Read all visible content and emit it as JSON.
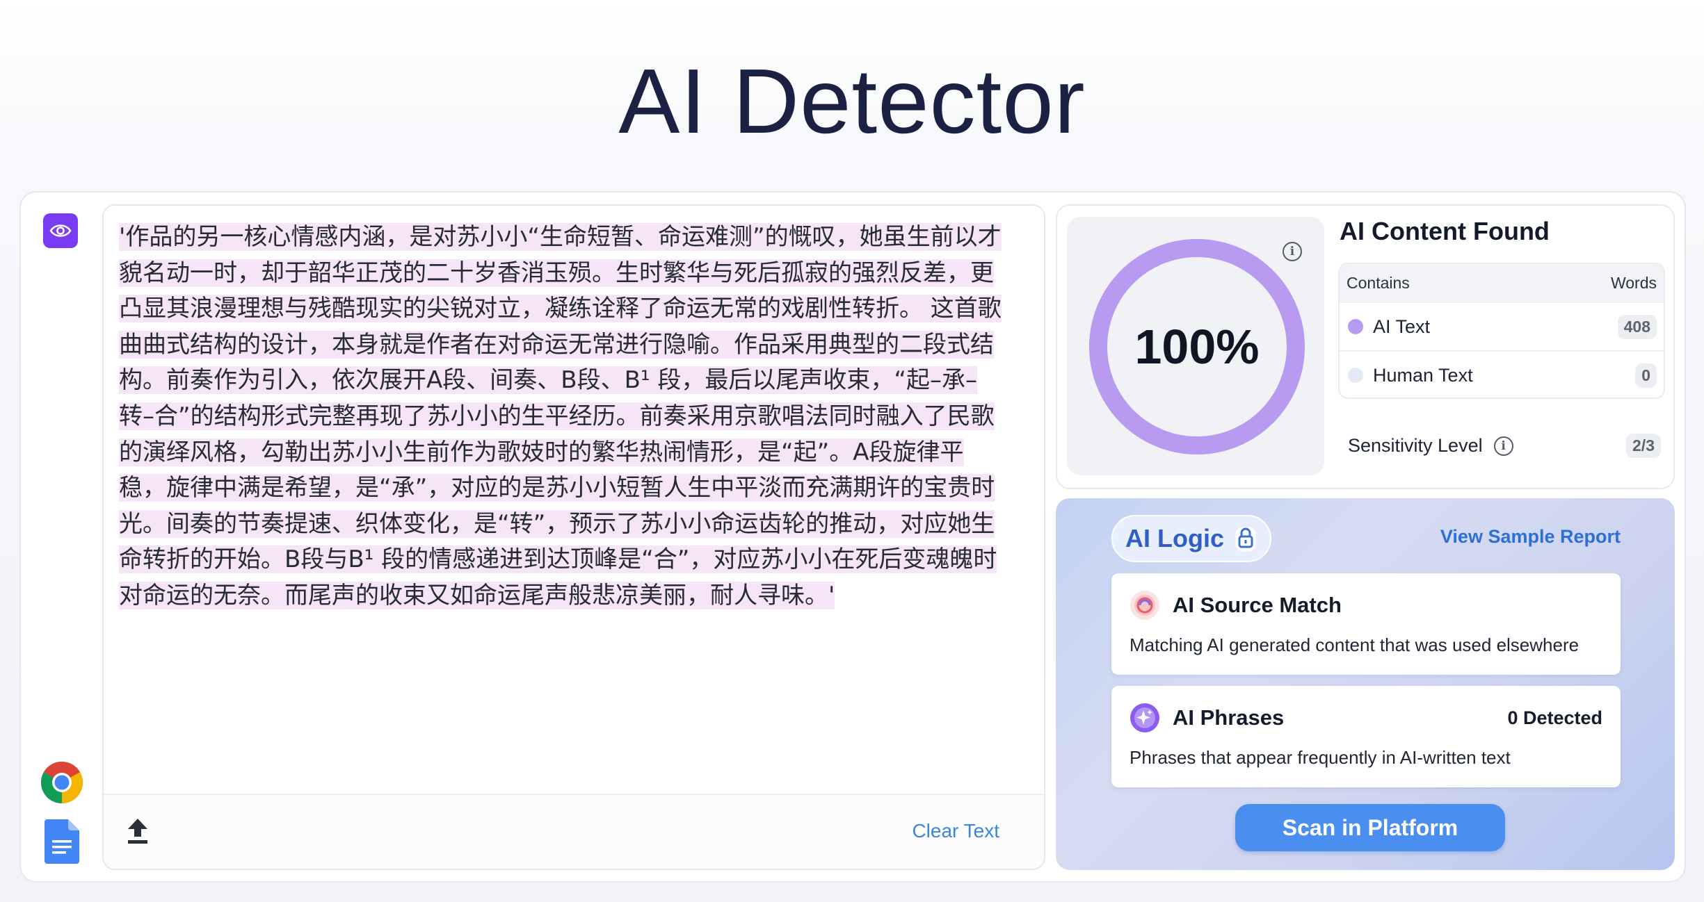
{
  "page": {
    "title": "AI Detector"
  },
  "editor": {
    "text": "'作品的另一核心情感内涵，是对苏小小“生命短暂、命运难测”的慨叹，她虽生前以才貌名动一时，却于韶华正茂的二十岁香消玉殒。生时繁华与死后孤寂的强烈反差，更凸显其浪漫理想与残酷现实的尖锐对立，凝练诠释了命运无常的戏剧性转折。 这首歌曲曲式结构的设计，本身就是作者在对命运无常进行隐喻。作品采用典型的二段式结构。前奏作为引入，依次展开A段、间奏、B段、B¹ 段，最后以尾声收束，“起–承–转–合”的结构形式完整再现了苏小小的生平经历。前奏采用京歌唱法同时融入了民歌的演绎风格，勾勒出苏小小生前作为歌妓时的繁华热闹情形，是“起”。A段旋律平稳，旋律中满是希望，是“承”，对应的是苏小小短暂人生中平淡而充满期许的宝贵时光。间奏的节奏提速、织体变化，是“转”，预示了苏小小命运齿轮的推动，对应她生命转折的开始。B段与B¹ 段的情感递进到达顶峰是“合”，对应苏小小在死后变魂魄时对命运的无奈。而尾声的收束又如命运尾声般悲凉美丽，耐人寻味。'",
    "clear_label": "Clear Text",
    "icons": {
      "view": "eye-icon",
      "upload": "upload-icon",
      "chrome": "chrome-icon",
      "docs": "google-docs-icon"
    }
  },
  "result": {
    "percent_label": "100%",
    "percent": 100,
    "title": "AI Content Found",
    "table_header": {
      "contains": "Contains",
      "words": "Words"
    },
    "rows": [
      {
        "label": "AI Text",
        "count": "408",
        "color": "#b89af0"
      },
      {
        "label": "Human Text",
        "count": "0",
        "color": "#e4e9f8"
      }
    ],
    "sensitivity_label": "Sensitivity Level",
    "sensitivity_value": "2/3"
  },
  "ai_logic": {
    "label": "AI Logic",
    "sample_link": "View Sample Report",
    "source_match": {
      "title": "AI Source Match",
      "desc": "Matching AI generated content that was used elsewhere"
    },
    "phrases": {
      "title": "AI Phrases",
      "count": "0 Detected",
      "desc": "Phrases that appear frequently in AI-written text"
    },
    "scan_button": "Scan in Platform"
  },
  "colors": {
    "accent": "#7a3cf2",
    "gauge": "#b89af0",
    "link": "#3a86e0",
    "scan": "#4a8ff0"
  }
}
